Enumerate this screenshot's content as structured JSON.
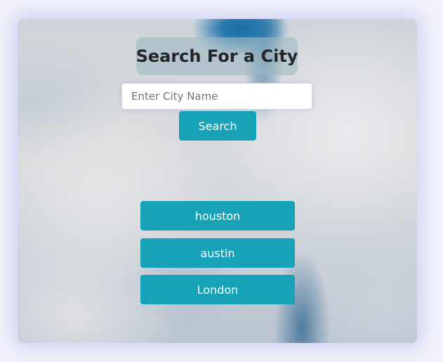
{
  "search": {
    "title": "Search For a City",
    "placeholder": "Enter City Name",
    "button_label": "Search"
  },
  "saved_cities": [
    {
      "label": "houston"
    },
    {
      "label": "austin"
    },
    {
      "label": "London"
    }
  ],
  "colors": {
    "button": "#17a2b8",
    "page_background": "#f2f2fa"
  }
}
